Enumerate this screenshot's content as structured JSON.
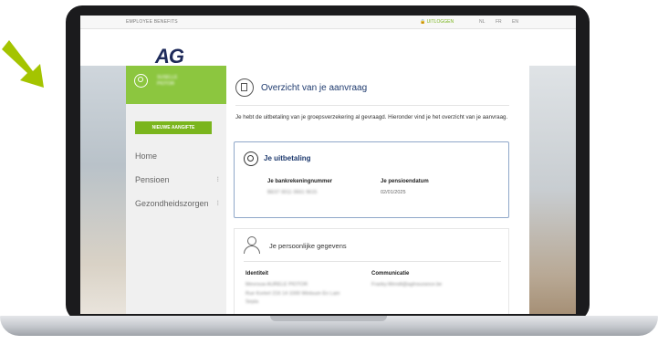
{
  "topbar": {
    "brand": "EMPLOYEE BENEFITS",
    "logout": "UITLOGGEN",
    "languages": [
      "NL",
      "FR",
      "EN"
    ]
  },
  "logo": "AG",
  "user": {
    "name_line1": "SUSELLE",
    "name_line2": "PIOTOR"
  },
  "sidebar": {
    "new_button": "NIEUWE AANGIFTE",
    "items": [
      {
        "label": "Home",
        "more": ""
      },
      {
        "label": "Pensioen",
        "more": "⁝"
      },
      {
        "label": "Gezondheidszorgen",
        "more": "⁝"
      }
    ]
  },
  "overview": {
    "title": "Overzicht van je aanvraag",
    "intro": "Je hebt de uitbetaling van je groepsverzekering al gevraagd. Hieronder vind je het overzicht van je aanvraag."
  },
  "payment": {
    "title": "Je uitbetaling",
    "bank_label": "Je bankrekeningnummer",
    "bank_value": "BE07 0011 0661 9615",
    "pension_label": "Je pensioendatum",
    "pension_value": "02/01/2025"
  },
  "personal": {
    "title": "Je persoonlijke gegevens",
    "identity_label": "Identiteit",
    "identity_value": "Mevrouw AURELE PIOTOR",
    "address_value": "Rue Korterl 216 14 1000 Wintsum En Lam",
    "address_value2": "Sepia",
    "comm_label": "Communicatie",
    "comm_value": "Franky.Wendt@agInsurance.be"
  },
  "colors": {
    "accent_green": "#8cc63f",
    "navy": "#1e3a6e",
    "card_border": "#8fa7c9"
  }
}
